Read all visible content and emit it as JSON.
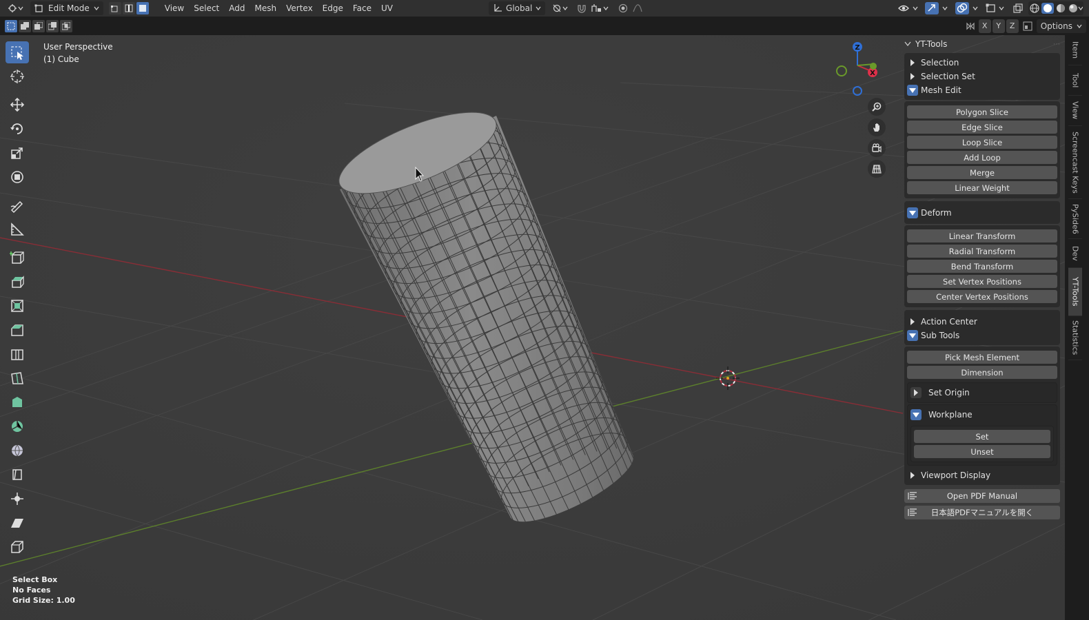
{
  "header": {
    "mode": "Edit Mode",
    "menus": [
      "View",
      "Select",
      "Add",
      "Mesh",
      "Vertex",
      "Edge",
      "Face",
      "UV"
    ],
    "transform_orientation": "Global",
    "options_label": "Options",
    "axes": [
      "X",
      "Y",
      "Z"
    ]
  },
  "viewport": {
    "view_name": "User Perspective",
    "object_name": "(1) Cube",
    "gizmo_axes": {
      "x": "X",
      "y": "Y",
      "z": "Z"
    }
  },
  "status": {
    "tool": "Select Box",
    "selection": "No Faces",
    "grid": "Grid Size: 1.00"
  },
  "panel": {
    "title": "YT-Tools",
    "sections": {
      "selection": "Selection",
      "selection_set": "Selection Set",
      "mesh_edit": "Mesh Edit",
      "deform": "Deform",
      "action_center": "Action Center",
      "sub_tools": "Sub Tools",
      "set_origin": "Set Origin",
      "workplane": "Workplane",
      "viewport_display": "Viewport Display"
    },
    "mesh_edit_buttons": [
      "Polygon Slice",
      "Edge Slice",
      "Loop Slice",
      "Add Loop",
      "Merge",
      "Linear Weight"
    ],
    "deform_buttons": [
      "Linear Transform",
      "Radial Transform",
      "Bend Transform",
      "Set Vertex Positions",
      "Center Vertex Positions"
    ],
    "sub_tools_buttons": [
      "Pick Mesh Element",
      "Dimension"
    ],
    "workplane_buttons": [
      "Set",
      "Unset"
    ],
    "manual_en": "Open PDF Manual",
    "manual_ja": "日本語PDFマニュアルを開く"
  },
  "tabs": [
    "Item",
    "Tool",
    "View",
    "Screencast Keys",
    "PySide6",
    "Dev",
    "YT-Tools",
    "Statistics"
  ],
  "colors": {
    "accent": "#4772b3",
    "x_axis": "#c8303f",
    "y_axis": "#6a9a2a",
    "z_axis": "#2f6fd6"
  }
}
